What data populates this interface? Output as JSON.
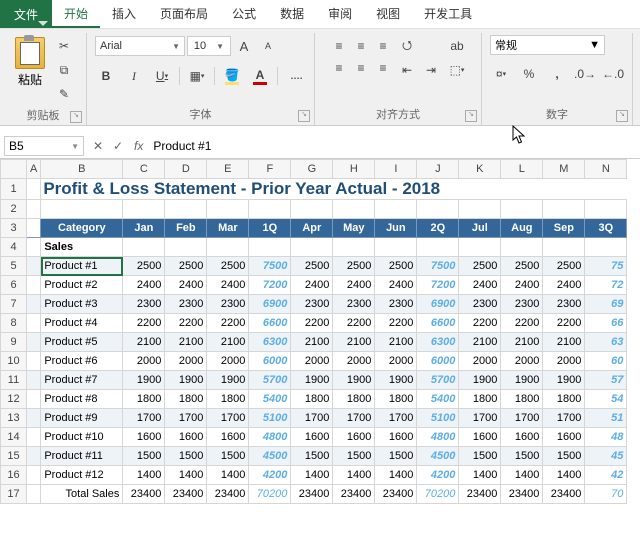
{
  "app": {
    "file_tab": "文件"
  },
  "tabs": [
    "开始",
    "插入",
    "页面布局",
    "公式",
    "数据",
    "审阅",
    "视图",
    "开发工具"
  ],
  "active_tab": 0,
  "ribbon": {
    "clipboard": {
      "paste": "粘贴",
      "title": "剪贴板"
    },
    "font": {
      "name": "Arial",
      "size": "10",
      "bold": "B",
      "italic": "I",
      "underline": "U",
      "title": "字体"
    },
    "alignment": {
      "title": "对齐方式",
      "wrap": "ab"
    },
    "number": {
      "format": "常规",
      "title": "数字",
      "percent": "%"
    }
  },
  "namebox": "B5",
  "fx_value": "Product #1",
  "columns": [
    "A",
    "B",
    "C",
    "D",
    "E",
    "F",
    "G",
    "H",
    "I",
    "J",
    "K",
    "L",
    "M",
    "N"
  ],
  "title": "Profit & Loss Statement - Prior Year Actual - 2018",
  "header": [
    "Category",
    "Jan",
    "Feb",
    "Mar",
    "1Q",
    "Apr",
    "May",
    "Jun",
    "2Q",
    "Jul",
    "Aug",
    "Sep",
    "3Q"
  ],
  "section": "Sales",
  "rows": [
    {
      "name": "Product #1",
      "vals": [
        2500,
        2500,
        2500,
        7500,
        2500,
        2500,
        2500,
        7500,
        2500,
        2500,
        2500,
        "75"
      ]
    },
    {
      "name": "Product #2",
      "vals": [
        2400,
        2400,
        2400,
        7200,
        2400,
        2400,
        2400,
        7200,
        2400,
        2400,
        2400,
        "72"
      ]
    },
    {
      "name": "Product #3",
      "vals": [
        2300,
        2300,
        2300,
        6900,
        2300,
        2300,
        2300,
        6900,
        2300,
        2300,
        2300,
        "69"
      ]
    },
    {
      "name": "Product #4",
      "vals": [
        2200,
        2200,
        2200,
        6600,
        2200,
        2200,
        2200,
        6600,
        2200,
        2200,
        2200,
        "66"
      ]
    },
    {
      "name": "Product #5",
      "vals": [
        2100,
        2100,
        2100,
        6300,
        2100,
        2100,
        2100,
        6300,
        2100,
        2100,
        2100,
        "63"
      ]
    },
    {
      "name": "Product #6",
      "vals": [
        2000,
        2000,
        2000,
        6000,
        2000,
        2000,
        2000,
        6000,
        2000,
        2000,
        2000,
        "60"
      ]
    },
    {
      "name": "Product #7",
      "vals": [
        1900,
        1900,
        1900,
        5700,
        1900,
        1900,
        1900,
        5700,
        1900,
        1900,
        1900,
        "57"
      ]
    },
    {
      "name": "Product #8",
      "vals": [
        1800,
        1800,
        1800,
        5400,
        1800,
        1800,
        1800,
        5400,
        1800,
        1800,
        1800,
        "54"
      ]
    },
    {
      "name": "Product #9",
      "vals": [
        1700,
        1700,
        1700,
        5100,
        1700,
        1700,
        1700,
        5100,
        1700,
        1700,
        1700,
        "51"
      ]
    },
    {
      "name": "Product #10",
      "vals": [
        1600,
        1600,
        1600,
        4800,
        1600,
        1600,
        1600,
        4800,
        1600,
        1600,
        1600,
        "48"
      ]
    },
    {
      "name": "Product #11",
      "vals": [
        1500,
        1500,
        1500,
        4500,
        1500,
        1500,
        1500,
        4500,
        1500,
        1500,
        1500,
        "45"
      ]
    },
    {
      "name": "Product #12",
      "vals": [
        1400,
        1400,
        1400,
        4200,
        1400,
        1400,
        1400,
        4200,
        1400,
        1400,
        1400,
        "42"
      ]
    }
  ],
  "total": {
    "name": "Total Sales",
    "vals": [
      23400,
      23400,
      23400,
      70200,
      23400,
      23400,
      23400,
      70200,
      23400,
      23400,
      23400,
      "70"
    ]
  },
  "quarter_cols": [
    3,
    7,
    11
  ],
  "chart_data": {
    "type": "table",
    "title": "Profit & Loss Statement - Prior Year Actual - 2018",
    "columns": [
      "Category",
      "Jan",
      "Feb",
      "Mar",
      "1Q",
      "Apr",
      "May",
      "Jun",
      "2Q",
      "Jul",
      "Aug",
      "Sep"
    ],
    "rows": [
      [
        "Product #1",
        2500,
        2500,
        2500,
        7500,
        2500,
        2500,
        2500,
        7500,
        2500,
        2500,
        2500
      ],
      [
        "Product #2",
        2400,
        2400,
        2400,
        7200,
        2400,
        2400,
        2400,
        7200,
        2400,
        2400,
        2400
      ],
      [
        "Product #3",
        2300,
        2300,
        2300,
        6900,
        2300,
        2300,
        2300,
        6900,
        2300,
        2300,
        2300
      ],
      [
        "Product #4",
        2200,
        2200,
        2200,
        6600,
        2200,
        2200,
        2200,
        6600,
        2200,
        2200,
        2200
      ],
      [
        "Product #5",
        2100,
        2100,
        2100,
        6300,
        2100,
        2100,
        2100,
        6300,
        2100,
        2100,
        2100
      ],
      [
        "Product #6",
        2000,
        2000,
        2000,
        6000,
        2000,
        2000,
        2000,
        6000,
        2000,
        2000,
        2000
      ],
      [
        "Product #7",
        1900,
        1900,
        1900,
        5700,
        1900,
        1900,
        1900,
        5700,
        1900,
        1900,
        1900
      ],
      [
        "Product #8",
        1800,
        1800,
        1800,
        5400,
        1800,
        1800,
        1800,
        5400,
        1800,
        1800,
        1800
      ],
      [
        "Product #9",
        1700,
        1700,
        1700,
        5100,
        1700,
        1700,
        1700,
        5100,
        1700,
        1700,
        1700
      ],
      [
        "Product #10",
        1600,
        1600,
        1600,
        4800,
        1600,
        1600,
        1600,
        4800,
        1600,
        1600,
        1600
      ],
      [
        "Product #11",
        1500,
        1500,
        1500,
        4500,
        1500,
        1500,
        1500,
        4500,
        1500,
        1500,
        1500
      ],
      [
        "Product #12",
        1400,
        1400,
        1400,
        4200,
        1400,
        1400,
        1400,
        4200,
        1400,
        1400,
        1400
      ],
      [
        "Total Sales",
        23400,
        23400,
        23400,
        70200,
        23400,
        23400,
        23400,
        70200,
        23400,
        23400,
        23400
      ]
    ]
  }
}
